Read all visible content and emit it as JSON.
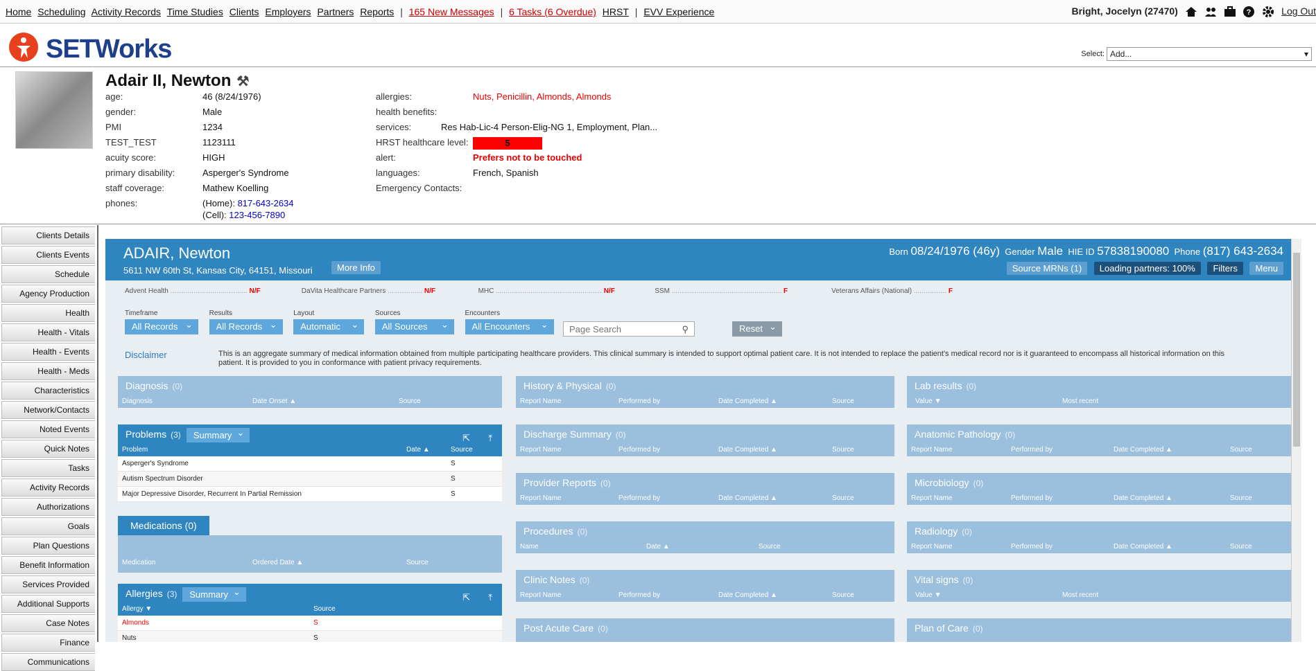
{
  "nav": {
    "links": [
      "Home",
      "Scheduling",
      "Activity Records",
      "Time Studies",
      "Clients",
      "Employers",
      "Partners",
      "Reports"
    ],
    "messages": "165 New Messages",
    "tasks": "6 Tasks (6 Overdue)",
    "hrst": "HRST",
    "evv": "EVV Experience",
    "user": "Bright, Jocelyn  (27470)",
    "logout": "Log Out"
  },
  "logo": {
    "text": "SETWorks"
  },
  "select": {
    "label": "Select:",
    "value": "Add..."
  },
  "client": {
    "name": "Adair II, Newton",
    "left": [
      {
        "k": "age:",
        "v": "46 (8/24/1976)"
      },
      {
        "k": "gender:",
        "v": "Male"
      },
      {
        "k": "PMI",
        "v": "1234"
      },
      {
        "k": "TEST_TEST",
        "v": "1123111"
      },
      {
        "k": "acuity score:",
        "v": "HIGH"
      },
      {
        "k": "primary disability:",
        "v": "Asperger's Syndrome"
      },
      {
        "k": "staff coverage:",
        "v": "Mathew Koelling"
      },
      {
        "k": "phones:",
        "v": ""
      }
    ],
    "phones": {
      "home_label": "(Home): ",
      "home": "817-643-2634",
      "cell_label": "(Cell): ",
      "cell": "123-456-7890"
    },
    "right": [
      {
        "k": "allergies:",
        "v": "Nuts, Penicillin, Almonds, Almonds"
      },
      {
        "k": "health benefits:",
        "v": ""
      },
      {
        "k": "services:",
        "v": "Res Hab-Lic-4 Person-Elig-NG 1, Employment, Plan..."
      },
      {
        "k": "HRST healthcare level:",
        "v": "5"
      },
      {
        "k": "alert:",
        "v": "Prefers not to be touched"
      },
      {
        "k": "languages:",
        "v": "French, Spanish"
      },
      {
        "k": "Emergency Contacts:",
        "v": ""
      }
    ]
  },
  "sidebar": [
    "Clients Details",
    "Clients Events",
    "Schedule",
    "Agency Production",
    "Health",
    "Health - Vitals",
    "Health - Events",
    "Health - Meds",
    "Characteristics",
    "Network/Contacts",
    "Noted Events",
    "Quick Notes",
    "Tasks",
    "Activity Records",
    "Authorizations",
    "Goals",
    "Plan Questions",
    "Benefit Information",
    "Services Provided",
    "Additional Supports",
    "Case Notes",
    "Finance",
    "Communications"
  ],
  "banner": {
    "name": "ADAIR, Newton",
    "address": "5611 NW 60th St, Kansas City, 64151, Missouri",
    "more_info": "More Info",
    "born_label": "Born",
    "born": "08/24/1976 (46y)",
    "gender_label": "Gender",
    "gender": "Male",
    "hie_label": "HIE ID",
    "hie": "57838190080",
    "phone_label": "Phone",
    "phone": "(817) 643-2634",
    "source_mrns": "Source MRNs (1)",
    "loading": "Loading partners: 100%",
    "filters": "Filters",
    "menu": "Menu"
  },
  "partners": [
    {
      "name": "Advent Health",
      "status": "N/F"
    },
    {
      "name": "DaVita Healthcare Partners",
      "status": "N/F"
    },
    {
      "name": "MHC",
      "status": "N/F"
    },
    {
      "name": "SSM",
      "status": "F"
    },
    {
      "name": "Veterans Affairs (National)",
      "status": "F"
    }
  ],
  "filters": [
    {
      "label": "Timeframe",
      "value": "All Records"
    },
    {
      "label": "Results",
      "value": "All Records"
    },
    {
      "label": "Layout",
      "value": "Automatic"
    },
    {
      "label": "Sources",
      "value": "All Sources"
    },
    {
      "label": "Encounters",
      "value": "All Encounters"
    }
  ],
  "search": {
    "placeholder": "Page Search"
  },
  "reset": "Reset",
  "disclaimer": {
    "label": "Disclaimer",
    "text": "This is an aggregate summary of medical information obtained from multiple participating healthcare providers. This clinical summary is intended to support optimal patient care. It is not intended to replace the patient's medical record nor is it guaranteed to encompass all historical information on this patient. It is provided to you in conformance with patient privacy requirements."
  },
  "cards": {
    "diagnosis": {
      "title": "Diagnosis",
      "count": "(0)",
      "cols": [
        "Diagnosis",
        "Date Onset ▲",
        "Source"
      ]
    },
    "problems": {
      "title": "Problems",
      "count": "(3)",
      "summary": "Summary",
      "cols": [
        "Problem",
        "Date ▲",
        "Source"
      ],
      "rows": [
        [
          "Asperger's Syndrome",
          "",
          "S"
        ],
        [
          "Autism Spectrum Disorder",
          "",
          "S"
        ],
        [
          "Major Depressive Disorder, Recurrent In Partial Remission",
          "",
          "S"
        ]
      ]
    },
    "medications": {
      "title": "Medications",
      "count": "(0)",
      "cols": [
        "Medication",
        "Ordered Date ▲",
        "Source"
      ]
    },
    "allergies": {
      "title": "Allergies",
      "count": "(3)",
      "summary": "Summary",
      "cols": [
        "Allergy ▼",
        "Source"
      ],
      "rows": [
        [
          "Almonds",
          "S"
        ],
        [
          "Nuts",
          "S"
        ]
      ]
    },
    "history": {
      "title": "History & Physical",
      "count": "(0)",
      "cols": [
        "Report Name",
        "Performed by",
        "Date Completed ▲",
        "Source"
      ]
    },
    "discharge": {
      "title": "Discharge Summary",
      "count": "(0)",
      "cols": [
        "Report Name",
        "Performed by",
        "Date Completed ▲",
        "Source"
      ]
    },
    "provider": {
      "title": "Provider Reports",
      "count": "(0)",
      "cols": [
        "Report Name",
        "Performed by",
        "Date Completed ▲",
        "Source"
      ]
    },
    "procedures": {
      "title": "Procedures",
      "count": "(0)",
      "cols": [
        "Name",
        "Date ▲",
        "Source"
      ]
    },
    "clinic": {
      "title": "Clinic Notes",
      "count": "(0)",
      "cols": [
        "Report Name",
        "Performed by",
        "Date Completed ▲",
        "Source"
      ]
    },
    "postacute": {
      "title": "Post Acute Care",
      "count": "(0)"
    },
    "lab": {
      "title": "Lab results",
      "count": "(0)",
      "cols": [
        "Value ▼",
        "Most recent"
      ]
    },
    "anatomic": {
      "title": "Anatomic Pathology",
      "count": "(0)",
      "cols": [
        "Report Name",
        "Performed by",
        "Date Completed ▲",
        "Source"
      ]
    },
    "micro": {
      "title": "Microbiology",
      "count": "(0)",
      "cols": [
        "Report Name",
        "Performed by",
        "Date Completed ▲",
        "Source"
      ]
    },
    "radiology": {
      "title": "Radiology",
      "count": "(0)",
      "cols": [
        "Report Name",
        "Performed by",
        "Date Completed ▲",
        "Source"
      ]
    },
    "vitals": {
      "title": "Vital signs",
      "count": "(0)",
      "cols": [
        "Value ▼",
        "Most recent"
      ]
    },
    "plan": {
      "title": "Plan of Care",
      "count": "(0)"
    }
  }
}
